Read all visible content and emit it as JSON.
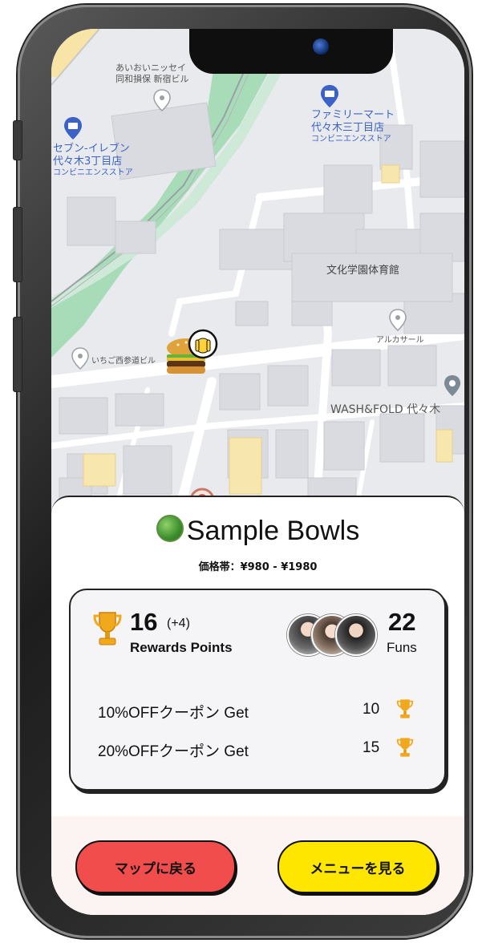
{
  "map": {
    "labels": {
      "aioi": "あいおいニッセイ",
      "aioi2": "同和損保 新宿ビル",
      "familymart": "ファミリーマート",
      "familymart2": "代々木三丁目店",
      "familymart_type": "コンビニエンスストア",
      "seven": "セブン-イレブン",
      "seven2": "代々木3丁目店",
      "seven_type": "コンビニエンスストア",
      "bunka": "文化学園体育館",
      "alka": "アルカサール",
      "ichigo": "いちご西参道ビル",
      "wash": "WASH&FOLD 代々木"
    },
    "pins": {
      "restaurant_pin_icon": "burger-icon",
      "user_pin_icon": "user-face-icon"
    }
  },
  "sheet": {
    "title": "Sample Bowls",
    "price": "価格帯：¥980 - ¥1980",
    "points": "16",
    "points_delta": "(+4)",
    "points_label": "Rewards Points",
    "funs": "22",
    "funs_label": "Funs",
    "coupons": [
      {
        "label": "10%OFFクーポン Get",
        "points": "10"
      },
      {
        "label": "20%OFFクーポン Get",
        "points": "15"
      }
    ],
    "btn_back": "マップに戻る",
    "btn_menu": "メニューを見る"
  },
  "colors": {
    "back_button": "#f24d4d",
    "menu_button": "#ffe600",
    "map_blue": "#3b63c7",
    "park_green": "#a8dcb9"
  }
}
